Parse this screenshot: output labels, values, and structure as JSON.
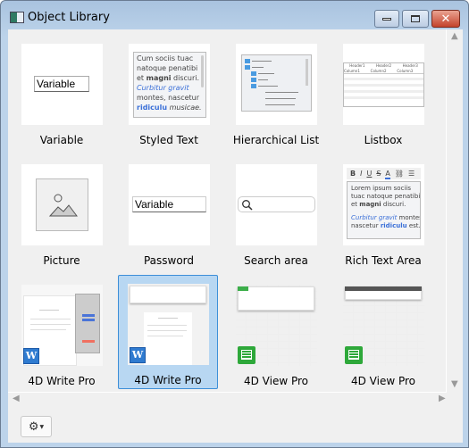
{
  "window": {
    "title": "Object Library",
    "minimize": "minimize",
    "maximize": "maximize",
    "close": "✕"
  },
  "items": [
    {
      "label": "Variable",
      "preview_text": "Variable"
    },
    {
      "label": "Styled Text",
      "preview": {
        "line1": "Cum sociis tuac",
        "line2": "natoque penatibi",
        "line3_a": "et ",
        "line3_b": "magni",
        "line3_c": " discuri.",
        "line4": "Curbitur gravit",
        "line5": "montes, nascetur",
        "line6_a": "ridiculu",
        "line6_b": " musicae."
      }
    },
    {
      "label": "Hierarchical List"
    },
    {
      "label": "Listbox",
      "preview": {
        "headers": [
          "Header1",
          "Header2",
          "Header3"
        ],
        "columns": [
          "Column1",
          "Column2",
          "Column3"
        ]
      }
    },
    {
      "label": "Picture"
    },
    {
      "label": "Password",
      "preview_text": "Variable"
    },
    {
      "label": "Search area"
    },
    {
      "label": "Rich Text Area",
      "preview": {
        "toolbar": [
          "B",
          "I",
          "U",
          "S",
          "A"
        ],
        "line1": "Lorem ipsum sociis",
        "line2": "tuac natoque penatibi",
        "line3_a": "et ",
        "line3_b": "magni",
        "line3_c": " discuri.",
        "line4_a": "Curbitur gravit",
        "line4_b": " montes,",
        "line5_a": "nascetur ",
        "line5_b": "ridiculu",
        "line5_c": " est."
      }
    },
    {
      "label": "4D Write Pro",
      "badge": "W"
    },
    {
      "label": "4D Write Pro",
      "badge": "W",
      "selected": true
    },
    {
      "label": "4D View Pro"
    },
    {
      "label": "4D View Pro"
    }
  ],
  "colors": {
    "selection": "#b8d7f2",
    "write_badge": "#2f7bd0",
    "view_badge": "#2ea83a"
  }
}
